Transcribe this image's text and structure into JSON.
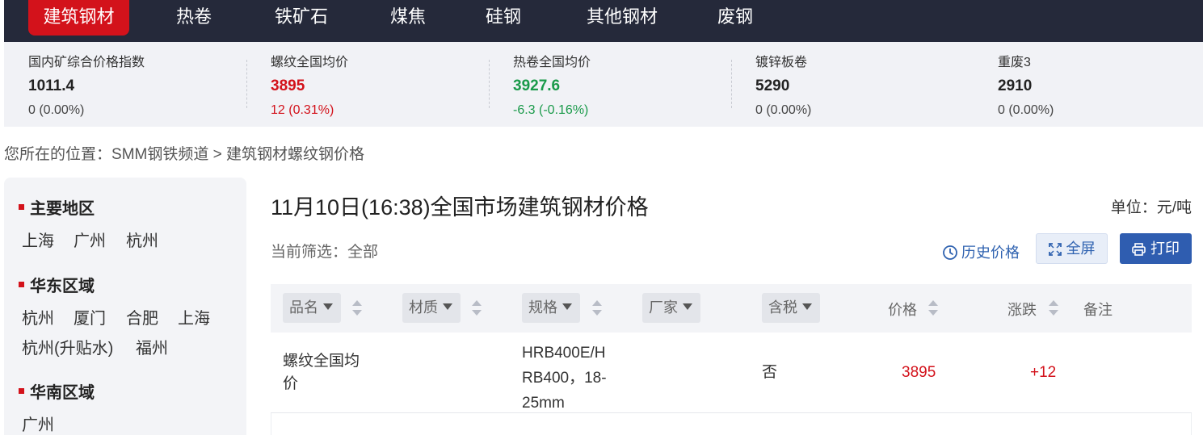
{
  "nav": {
    "items": [
      {
        "label": "建筑钢材",
        "active": true
      },
      {
        "label": "热卷",
        "active": false
      },
      {
        "label": "铁矿石",
        "active": false
      },
      {
        "label": "煤焦",
        "active": false
      },
      {
        "label": "硅钢",
        "active": false
      },
      {
        "label": "其他钢材",
        "active": false
      },
      {
        "label": "废钢",
        "active": false
      }
    ]
  },
  "ticker": [
    {
      "name": "国内矿综合价格指数",
      "price": "1011.4",
      "change": "0 (0.00%)",
      "trend": "flat"
    },
    {
      "name": "螺纹全国均价",
      "price": "3895",
      "change": "12 (0.31%)",
      "trend": "up"
    },
    {
      "name": "热卷全国均价",
      "price": "3927.6",
      "change": "-6.3 (-0.16%)",
      "trend": "down"
    },
    {
      "name": "镀锌板卷",
      "price": "5290",
      "change": "0 (0.00%)",
      "trend": "flat"
    },
    {
      "name": "重废3",
      "price": "2910",
      "change": "0 (0.00%)",
      "trend": "flat"
    }
  ],
  "breadcrumb": {
    "prefix": "您所在的位置：",
    "home": "SMM钢铁频道",
    "separator": " > ",
    "current": "建筑钢材螺纹钢价格"
  },
  "sidebar": {
    "regions": [
      {
        "title": "主要地区",
        "links": [
          "上海",
          "广州",
          "杭州"
        ]
      },
      {
        "title": "华东区域",
        "links": [
          "杭州",
          "厦门",
          "合肥",
          "上海",
          "杭州(升贴水)",
          "福州"
        ]
      },
      {
        "title": "华南区域",
        "links": [
          "广州"
        ]
      }
    ]
  },
  "main": {
    "title": "11月10日(16:38)全国市场建筑钢材价格",
    "unit": "单位：元/吨",
    "filter_label": "当前筛选：",
    "filter_value": "全部",
    "history_label": "历史价格",
    "fullscreen_label": "全屏",
    "print_label": "打印"
  },
  "table": {
    "headers": {
      "name": "品名",
      "material": "材质",
      "spec": "规格",
      "maker": "厂家",
      "tax": "含税",
      "price": "价格",
      "change": "涨跌",
      "note": "备注"
    },
    "rows": [
      {
        "name_line1": "螺纹全国均",
        "name_line2": "价",
        "material": "",
        "spec_line1": "HRB400E/H",
        "spec_line2": "RB400，18-",
        "spec_line3": "25mm",
        "maker": "",
        "tax": "否",
        "price": "3895",
        "change": "+12",
        "note": ""
      }
    ]
  },
  "colors": {
    "nav_bg": "#25293a",
    "accent_red": "#d3121b",
    "green": "#1a9a4a",
    "blue_button": "#2f5db0"
  }
}
